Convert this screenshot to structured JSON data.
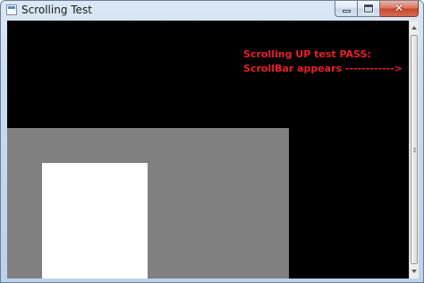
{
  "window": {
    "title": "Scrolling Test",
    "controls": {
      "minimize_icon": "minimize-icon",
      "maximize_icon": "maximize-icon",
      "close_icon": "close-icon",
      "close_glyph": "✕"
    }
  },
  "content": {
    "status_line_1": "Scrolling UP test PASS:",
    "status_line_2": "ScrollBar appears ------------>",
    "text_color": "#e8202a",
    "background_color": "#000000",
    "gray_panel_color": "#808080",
    "white_panel_color": "#ffffff"
  },
  "scrollbar": {
    "orientation": "vertical",
    "position_fraction": 0.0
  }
}
